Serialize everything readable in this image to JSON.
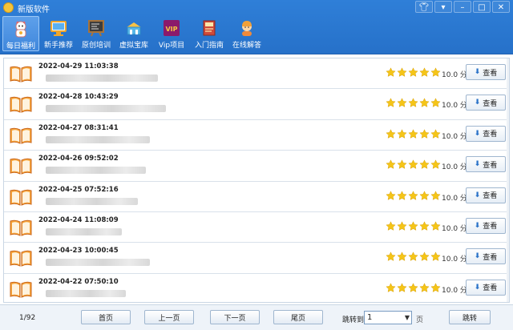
{
  "window": {
    "title": "新版软件",
    "controls": [
      "shirt-icon",
      "menu-icon",
      "minimize-icon",
      "maximize-icon",
      "close-icon"
    ]
  },
  "nav": [
    {
      "label": "每日福利",
      "icon": "lucky-cat-icon",
      "active": true
    },
    {
      "label": "新手推荐",
      "icon": "monitor-icon",
      "active": false
    },
    {
      "label": "原创培训",
      "icon": "blackboard-icon",
      "active": false
    },
    {
      "label": "虚拟宝库",
      "icon": "treasure-icon",
      "active": false
    },
    {
      "label": "Vip项目",
      "icon": "vip-icon",
      "active": false,
      "icon_text": "VIP"
    },
    {
      "label": "入门指南",
      "icon": "guide-book-icon",
      "active": false
    },
    {
      "label": "在线解答",
      "icon": "support-agent-icon",
      "active": false
    }
  ],
  "rows": [
    {
      "date": "2022-04-29 11:03:38",
      "score": "10.0 分",
      "view_label": "查看",
      "rating": 5
    },
    {
      "date": "2022-04-28 10:43:29",
      "score": "10.0 分",
      "view_label": "查看",
      "rating": 5
    },
    {
      "date": "2022-04-27 08:31:41",
      "score": "10.0 分",
      "view_label": "查看",
      "rating": 5
    },
    {
      "date": "2022-04-26 09:52:02",
      "score": "10.0 分",
      "view_label": "查看",
      "rating": 5
    },
    {
      "date": "2022-04-25 07:52:16",
      "score": "10.0 分",
      "view_label": "查看",
      "rating": 5
    },
    {
      "date": "2022-04-24 11:08:09",
      "score": "10.0 分",
      "view_label": "查看",
      "rating": 5
    },
    {
      "date": "2022-04-23 10:00:45",
      "score": "10.0 分",
      "view_label": "查看",
      "rating": 5
    },
    {
      "date": "2022-04-22 07:50:10",
      "score": "10.0 分",
      "view_label": "查看",
      "rating": 5
    }
  ],
  "footer": {
    "page_count": "1/92",
    "first": "首页",
    "prev": "上一页",
    "next": "下一页",
    "last": "尾页",
    "jump_label": "跳转到",
    "jump_value": "1",
    "page_unit": "页",
    "go": "跳转"
  },
  "colors": {
    "titlebar": "#2a76cf",
    "star": "#f5c518",
    "book": "#e07a1f"
  }
}
